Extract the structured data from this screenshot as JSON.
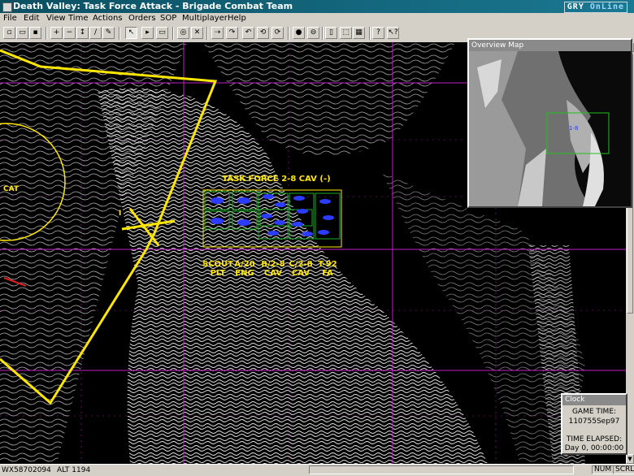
{
  "window": {
    "title": "Death Valley:  Task Force Attack - Brigade Combat Team",
    "watermark_a": "GRY",
    "watermark_b": "OnLine"
  },
  "menu": {
    "items": [
      {
        "label": "File"
      },
      {
        "label": "Edit"
      },
      {
        "label": "View"
      },
      {
        "label": "Time"
      },
      {
        "label": "Actions"
      },
      {
        "label": "Orders"
      },
      {
        "label": "SOP"
      },
      {
        "label": "Multiplayer"
      },
      {
        "label": "Help"
      }
    ]
  },
  "toolbar": {
    "icons": [
      "new-file-icon",
      "open-folder-icon",
      "save-icon",
      "zoom-in-icon",
      "zoom-out-icon",
      "scroll-icon",
      "line-icon",
      "graphic-icon",
      "select-pointer-icon",
      "unit-icon",
      "measure-icon",
      "compass-icon",
      "clock-icon",
      "move-icon",
      "hold-icon",
      "defend-icon",
      "attack-icon",
      "stop-icon",
      "go-icon",
      "split-icon",
      "merge-icon",
      "zoom-map-icon",
      "info-icon",
      "help-icon"
    ]
  },
  "map": {
    "task_force_label": "TASK FORCE 2-8 CAV (-)",
    "cat_label": "CAT",
    "phase_line_label": "I",
    "subunits": [
      {
        "line1": "SCOUT",
        "line2": "PLT"
      },
      {
        "line1": "A/20",
        "line2": "ENG"
      },
      {
        "line1": "B/2-8",
        "line2": "CAV"
      },
      {
        "line1": "C/2-8",
        "line2": "CAV"
      },
      {
        "line1": "T-92",
        "line2": "FA"
      }
    ]
  },
  "overview": {
    "title": "Overview Map",
    "marker_label": "1-8"
  },
  "clock": {
    "title": "Clock",
    "game_time_label": "GAME TIME:",
    "game_time": "110755Sep97",
    "elapsed_label": "TIME ELAPSED:",
    "elapsed": "Day 0, 00:00:00"
  },
  "status": {
    "coords": "WX58702094",
    "altitude": "ALT 1194",
    "num": "NUM",
    "scrl": "SCRL"
  },
  "colors": {
    "title_bar": "#0b4f62",
    "map_background": "#000000",
    "grid": "#c020c0",
    "phase_line": "#ffe600",
    "unit_box": "#1aa82a",
    "unit_icon": "#2b3cff"
  }
}
